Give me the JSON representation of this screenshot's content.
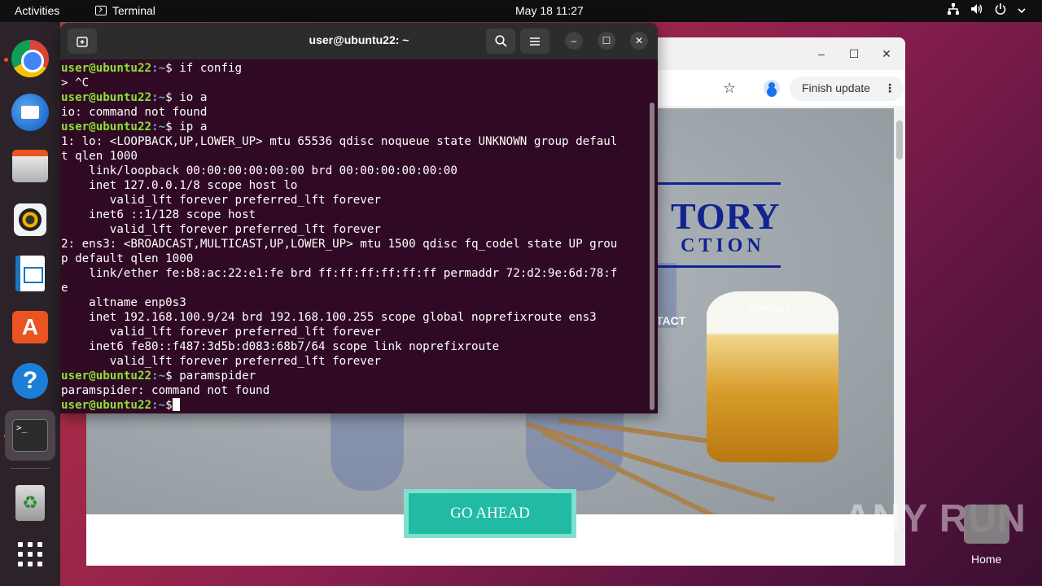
{
  "topbar": {
    "activities": "Activities",
    "app_name": "Terminal",
    "clock": "May 18  11:27"
  },
  "dock": {
    "items": [
      "Google Chrome",
      "Thunderbird Mail",
      "Files",
      "Rhythmbox",
      "LibreOffice Writer",
      "Ubuntu Software",
      "Help",
      "Terminal",
      "Trash",
      "Show Applications"
    ],
    "terminal_icon_text": ">_"
  },
  "terminal": {
    "title": "user@ubuntu22: ~",
    "prompt_user": "user@ubuntu22",
    "prompt_path": ":~",
    "prompt_symbol": "$",
    "lines": [
      {
        "type": "cmd",
        "text": " if config"
      },
      {
        "type": "out",
        "text": "> ^C"
      },
      {
        "type": "cmd",
        "text": " io a"
      },
      {
        "type": "out",
        "text": "io: command not found"
      },
      {
        "type": "cmd",
        "text": " ip a"
      },
      {
        "type": "out",
        "text": "1: lo: <LOOPBACK,UP,LOWER_UP> mtu 65536 qdisc noqueue state UNKNOWN group defaul"
      },
      {
        "type": "out",
        "text": "t qlen 1000"
      },
      {
        "type": "out",
        "text": "    link/loopback 00:00:00:00:00:00 brd 00:00:00:00:00:00"
      },
      {
        "type": "out",
        "text": "    inet 127.0.0.1/8 scope host lo"
      },
      {
        "type": "out",
        "text": "       valid_lft forever preferred_lft forever"
      },
      {
        "type": "out",
        "text": "    inet6 ::1/128 scope host"
      },
      {
        "type": "out",
        "text": "       valid_lft forever preferred_lft forever"
      },
      {
        "type": "out",
        "text": "2: ens3: <BROADCAST,MULTICAST,UP,LOWER_UP> mtu 1500 qdisc fq_codel state UP grou"
      },
      {
        "type": "out",
        "text": "p default qlen 1000"
      },
      {
        "type": "out",
        "text": "    link/ether fe:b8:ac:22:e1:fe brd ff:ff:ff:ff:ff:ff permaddr 72:d2:9e:6d:78:f"
      },
      {
        "type": "out",
        "text": "e"
      },
      {
        "type": "out",
        "text": "    altname enp0s3"
      },
      {
        "type": "out",
        "text": "    inet 192.168.100.9/24 brd 192.168.100.255 scope global noprefixroute ens3"
      },
      {
        "type": "out",
        "text": "       valid_lft forever preferred_lft forever"
      },
      {
        "type": "out",
        "text": "    inet6 fe80::f487:3d5b:d083:68b7/64 scope link noprefixroute"
      },
      {
        "type": "out",
        "text": "       valid_lft forever preferred_lft forever"
      },
      {
        "type": "cmd",
        "text": " paramspider"
      },
      {
        "type": "out",
        "text": "paramspider: command not found"
      },
      {
        "type": "cmd",
        "text": ""
      }
    ]
  },
  "browser": {
    "finish_update": "Finish update",
    "more_dots": "⋮",
    "page": {
      "logo_title": "TORY",
      "logo_sub": "CTION",
      "nav_contact": "TACT",
      "nav_contact_faint": "CONTACT",
      "cta": "GO AHEAD"
    }
  },
  "desktop": {
    "watermark": "ANY RUN",
    "home_label": "Home"
  }
}
